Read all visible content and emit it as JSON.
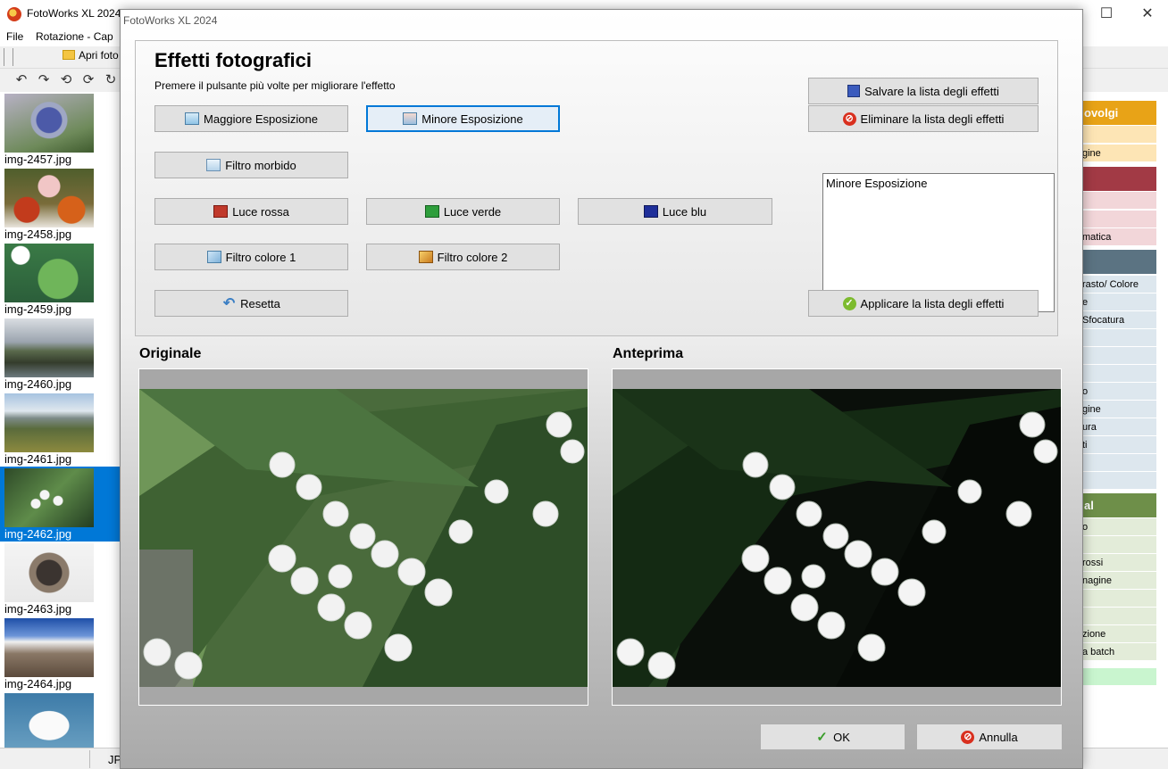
{
  "app": {
    "title": "FotoWorks XL 2024",
    "menu": [
      "File",
      "Rotazione - Cap"
    ],
    "open_label": "Apri foto",
    "window_controls": {
      "minimize": "—",
      "maximize": "☐",
      "close": "✕"
    }
  },
  "thumbnails": [
    {
      "label": "img-2457.jpg",
      "selected": false
    },
    {
      "label": "img-2458.jpg",
      "selected": false
    },
    {
      "label": "img-2459.jpg",
      "selected": false
    },
    {
      "label": "img-2460.jpg",
      "selected": false
    },
    {
      "label": "img-2461.jpg",
      "selected": false
    },
    {
      "label": "img-2462.jpg",
      "selected": true
    },
    {
      "label": "img-2463.jpg",
      "selected": false
    },
    {
      "label": "img-2464.jpg",
      "selected": false
    }
  ],
  "status": {
    "text": "JP"
  },
  "category_panel": {
    "heads": [
      {
        "label": "ovolgi",
        "color": "#e8a317"
      },
      {
        "label": "",
        "color": "#a23a45"
      },
      {
        "label": "",
        "color": "#5b7382"
      },
      {
        "label": "al",
        "color": "#6e8f49"
      }
    ],
    "rows": [
      "gine",
      "matica",
      "rasto/ Colore",
      "e",
      "Sfocatura",
      "o",
      "gine",
      "ura",
      "ti",
      "o",
      "rossi",
      "nagine",
      "zione",
      "a batch"
    ]
  },
  "dialog": {
    "title": "FotoWorks XL 2024",
    "heading": "Effetti fotografici",
    "hint": "Premere il pulsante più volte per migliorare l'effetto",
    "buttons": {
      "maggiore": "Maggiore Esposizione",
      "minore": "Minore Esposizione",
      "morbido": "Filtro morbido",
      "rossa": "Luce rossa",
      "verde": "Luce verde",
      "blu": "Luce blu",
      "colore1": "Filtro colore 1",
      "colore2": "Filtro colore 2",
      "resetta": "Resetta",
      "salvare": "Salvare la lista degli effetti",
      "eliminare": "Eliminare la lista degli effetti",
      "applicare": "Applicare la lista degli effetti",
      "ok": "OK",
      "annulla": "Annulla"
    },
    "effects_list": [
      "Minore Esposizione"
    ],
    "original_label": "Originale",
    "preview_label": "Anteprima"
  },
  "colors": {
    "selection": "#0078d7",
    "red_light": "#c0392b",
    "green_light": "#2e9e3c",
    "blue_light": "#1f2f9a"
  }
}
